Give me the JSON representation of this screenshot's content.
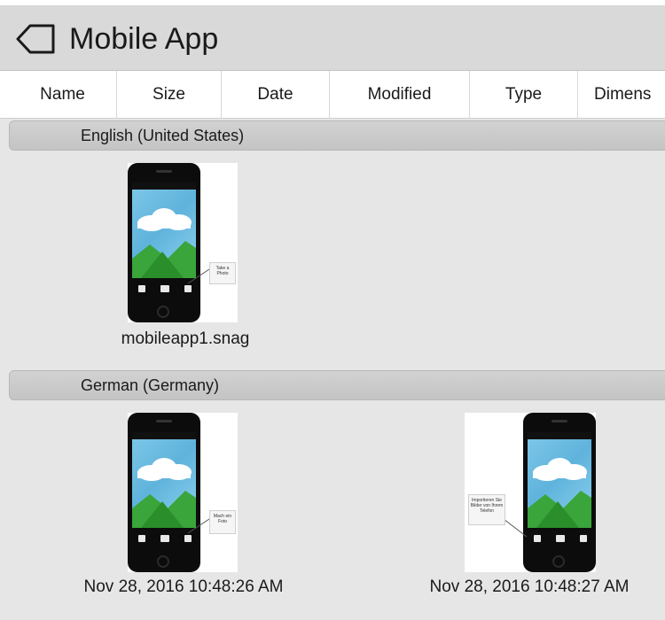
{
  "header": {
    "title": "Mobile App",
    "icon": "tag-icon"
  },
  "columns": [
    "Name",
    "Size",
    "Date",
    "Modified",
    "Type",
    "Dimens"
  ],
  "groups": [
    {
      "label": "English (United States)",
      "items": [
        {
          "caption": "mobileapp1.snag",
          "callout": "Take a Photo"
        }
      ]
    },
    {
      "label": "German (Germany)",
      "items": [
        {
          "caption": "Nov 28, 2016 10:48:26 AM",
          "callout": "Mach ein Foto"
        },
        {
          "caption": "Nov 28, 2016 10:48:27 AM",
          "callout": "Importieren Sie Bilder von Ihrem Telefon"
        }
      ]
    }
  ],
  "colors": {
    "header_bg": "#d9d9d9",
    "group_bg": "#c8c8c8",
    "body_bg": "#e6e6e6",
    "sky": "#6dbde3",
    "grass": "#2f9a2f"
  }
}
